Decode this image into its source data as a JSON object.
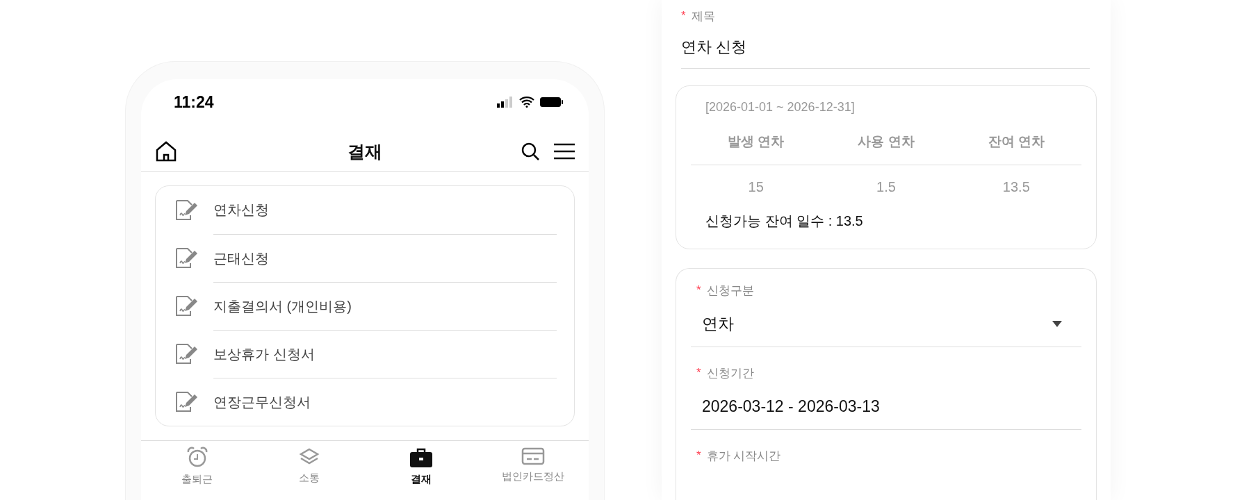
{
  "phone": {
    "status_bar": {
      "time": "11:24"
    },
    "header": {
      "title": "결재"
    },
    "menu": [
      {
        "label": "연차신청"
      },
      {
        "label": "근태신청"
      },
      {
        "label": "지출결의서 (개인비용)"
      },
      {
        "label": "보상휴가 신청서"
      },
      {
        "label": "연장근무신청서"
      }
    ],
    "tabs": [
      {
        "label": "출퇴근",
        "selected": false
      },
      {
        "label": "소통",
        "selected": false
      },
      {
        "label": "결재",
        "selected": true
      },
      {
        "label": "법인카드정산",
        "selected": false
      }
    ]
  },
  "form": {
    "title_field": {
      "mark": "*",
      "label": "제목",
      "value": "연차 신청"
    },
    "leave_summary": {
      "period": "[2026-01-01 ~ 2026-12-31]",
      "columns": [
        "발생 연차",
        "사용 연차",
        "잔여 연차"
      ],
      "values": [
        "15",
        "1.5",
        "13.5"
      ],
      "available": "신청가능 잔여 일수 : 13.5"
    },
    "fields": [
      {
        "kind": "select",
        "mark": "*",
        "label": "신청구분",
        "value": "연차"
      },
      {
        "kind": "text",
        "mark": "*",
        "label": "신청기간",
        "value": "2026-03-12 - 2026-03-13"
      },
      {
        "kind": "label",
        "mark": "*",
        "label": "휴가 시작시간"
      }
    ]
  }
}
